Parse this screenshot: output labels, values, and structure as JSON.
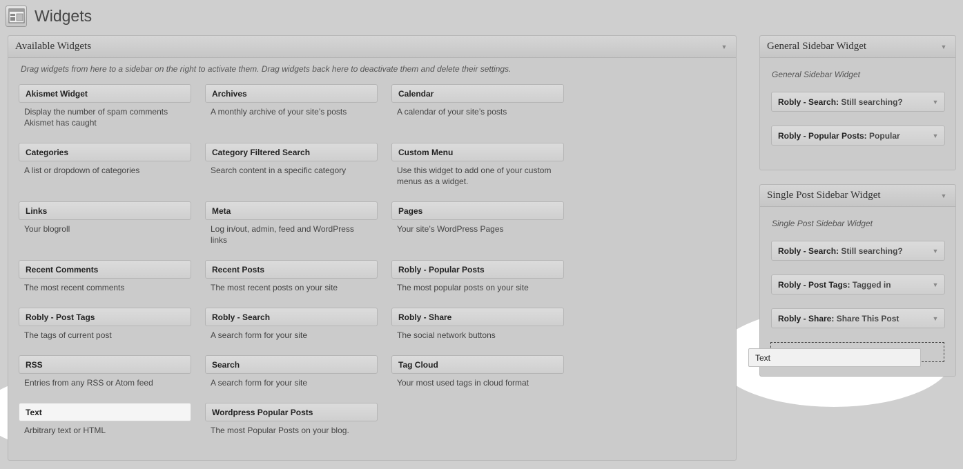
{
  "page": {
    "title": "Widgets",
    "icon": "widgets-icon"
  },
  "available": {
    "title": "Available Widgets",
    "help": "Drag widgets from here to a sidebar on the right to activate them. Drag widgets back here to deactivate them and delete their settings.",
    "widgets": [
      {
        "name": "Akismet Widget",
        "desc": "Display the number of spam comments Akismet has caught"
      },
      {
        "name": "Archives",
        "desc": "A monthly archive of your site’s posts"
      },
      {
        "name": "Calendar",
        "desc": "A calendar of your site’s posts"
      },
      {
        "name": "Categories",
        "desc": "A list or dropdown of categories"
      },
      {
        "name": "Category Filtered Search",
        "desc": "Search content in a specific category"
      },
      {
        "name": "Custom Menu",
        "desc": "Use this widget to add one of your custom menus as a widget."
      },
      {
        "name": "Links",
        "desc": "Your blogroll"
      },
      {
        "name": "Meta",
        "desc": "Log in/out, admin, feed and WordPress links"
      },
      {
        "name": "Pages",
        "desc": "Your site’s WordPress Pages"
      },
      {
        "name": "Recent Comments",
        "desc": "The most recent comments"
      },
      {
        "name": "Recent Posts",
        "desc": "The most recent posts on your site"
      },
      {
        "name": "Robly - Popular Posts",
        "desc": "The most popular posts on your site"
      },
      {
        "name": "Robly - Post Tags",
        "desc": "The tags of current post"
      },
      {
        "name": "Robly - Search",
        "desc": "A search form for your site"
      },
      {
        "name": "Robly - Share",
        "desc": "The social network buttons"
      },
      {
        "name": "RSS",
        "desc": "Entries from any RSS or Atom feed"
      },
      {
        "name": "Search",
        "desc": "A search form for your site"
      },
      {
        "name": "Tag Cloud",
        "desc": "Your most used tags in cloud format"
      },
      {
        "name": "Text",
        "desc": "Arbitrary text or HTML"
      },
      {
        "name": "Wordpress Popular Posts",
        "desc": "The most Popular Posts on your blog."
      }
    ]
  },
  "general": {
    "title": "General Sidebar Widget",
    "desc": "General Sidebar Widget",
    "widgets": [
      {
        "name": "Robly - Search:",
        "title": "Still searching?"
      },
      {
        "name": "Robly - Popular Posts:",
        "title": "Popular"
      }
    ]
  },
  "single": {
    "title": "Single Post Sidebar Widget",
    "desc": "Single Post Sidebar Widget",
    "widgets": [
      {
        "name": "Robly - Search:",
        "title": "Still searching?"
      },
      {
        "name": "Robly - Post Tags:",
        "title": "Tagged in"
      },
      {
        "name": "Robly - Share:",
        "title": "Share This Post"
      }
    ]
  },
  "dragging": {
    "label": "Text"
  },
  "caret_glyph": "▼"
}
